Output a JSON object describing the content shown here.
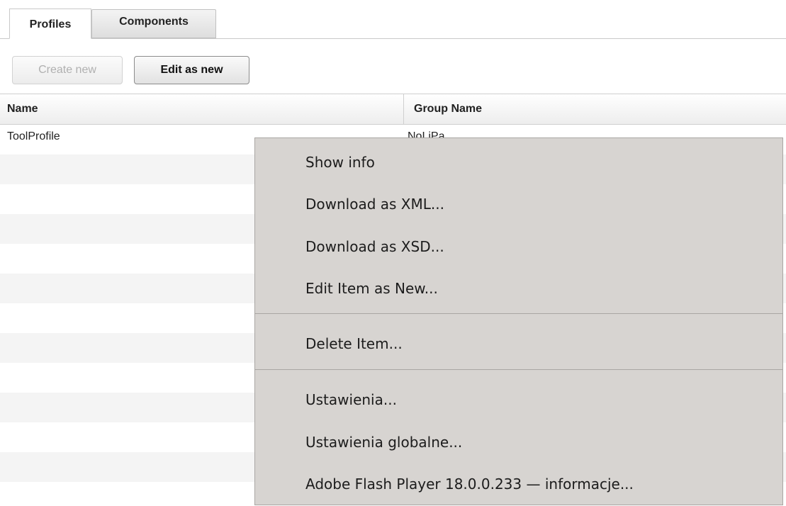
{
  "tabs": [
    {
      "label": "Profiles",
      "active": true
    },
    {
      "label": "Components",
      "active": false
    }
  ],
  "toolbar": {
    "create_new_label": "Create new",
    "edit_as_new_label": "Edit as new"
  },
  "table": {
    "columns": [
      "Name",
      "Group Name"
    ],
    "rows": [
      {
        "name": "ToolProfile",
        "group": "NoLiPa"
      }
    ]
  },
  "context_menu": {
    "items": [
      "Show info",
      "Download as XML...",
      "Download as XSD...",
      "Edit Item as New...",
      "Delete Item...",
      "Ustawienia...",
      "Ustawienia globalne...",
      "Adobe Flash Player 18.0.0.233 — informacje..."
    ]
  },
  "colors": {
    "menu_background": "#d7d4d1",
    "row_alt": "#f4f4f4",
    "disabled_text": "#b0b0b0"
  }
}
